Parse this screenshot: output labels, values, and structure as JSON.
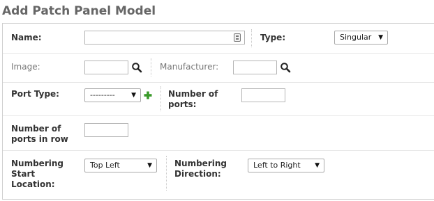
{
  "page": {
    "title": "Add Patch Panel Model"
  },
  "form": {
    "name": {
      "label": "Name:",
      "value": ""
    },
    "type": {
      "label": "Type:",
      "selected": "Singular"
    },
    "image": {
      "label": "Image:",
      "value": "",
      "icon": "search-icon"
    },
    "manufacturer": {
      "label": "Manufacturer:",
      "value": "",
      "icon": "search-icon"
    },
    "port_type": {
      "label": "Port Type:",
      "selected": "---------",
      "add_icon": "plus-icon"
    },
    "number_of_ports": {
      "label_line1": "Number of",
      "label_line2": "ports:",
      "value": ""
    },
    "number_of_ports_in_row": {
      "label_line1": "Number of",
      "label_line2": "ports in row",
      "value": ""
    },
    "numbering_start_location": {
      "label_line1": "Numbering",
      "label_line2": "Start",
      "label_line3": "Location:",
      "selected": "Top Left"
    },
    "numbering_direction": {
      "label_line1": "Numbering",
      "label_line2": "Direction:",
      "selected": "Left to Right"
    }
  },
  "colors": {
    "title": "#666666",
    "plus_icon": "#3a9a2a",
    "border": "#cfcfcf"
  }
}
